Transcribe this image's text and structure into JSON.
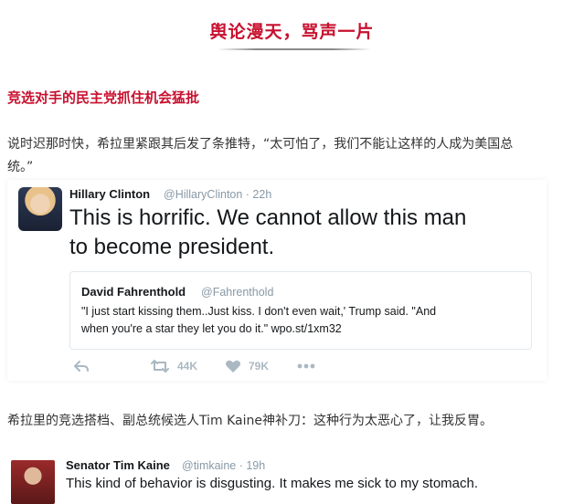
{
  "section_title": "舆论漫天，骂声一片",
  "subhead": "竞选对手的民主党抓住机会猛批",
  "paragraph1": {
    "line1": "说时迟那时快，希拉里紧跟其后发了条推特，“太可怕了，我们不能让这样的人成为美国总",
    "line2": "统。”"
  },
  "tweet_main": {
    "name": "Hillary Clinton",
    "handle": "@HillaryClinton · 22h",
    "text_line1": "This is horrific. We cannot allow this man",
    "text_line2": "to become president.",
    "quoted": {
      "name": "David Fahrenthold",
      "handle": "@Fahrenthold",
      "line1": "\"I just start kissing them..Just kiss. I don't even wait,' Trump said. \"And",
      "line2": "when you're a star they let you do it.\" wpo.st/1xm32"
    },
    "actions": {
      "reply_icon": "reply-icon",
      "retweet_icon": "retweet-icon",
      "retweets": "44K",
      "like_icon": "heart-icon",
      "likes": "79K",
      "more_icon": "more-icon"
    }
  },
  "paragraph2": "希拉里的竞选搭档、副总统候选人Tim Kaine神补刀：这种行为太恶心了，让我反胃。",
  "tweet_kaine": {
    "name": "Senator Tim Kaine",
    "handle": "@timkaine · 19h",
    "text": "This kind of behavior is disgusting. It makes me sick to my stomach."
  },
  "colors": {
    "accent_red": "#c8102e",
    "twitter_gray": "#aab8c2",
    "handle_gray": "#8899a6"
  }
}
